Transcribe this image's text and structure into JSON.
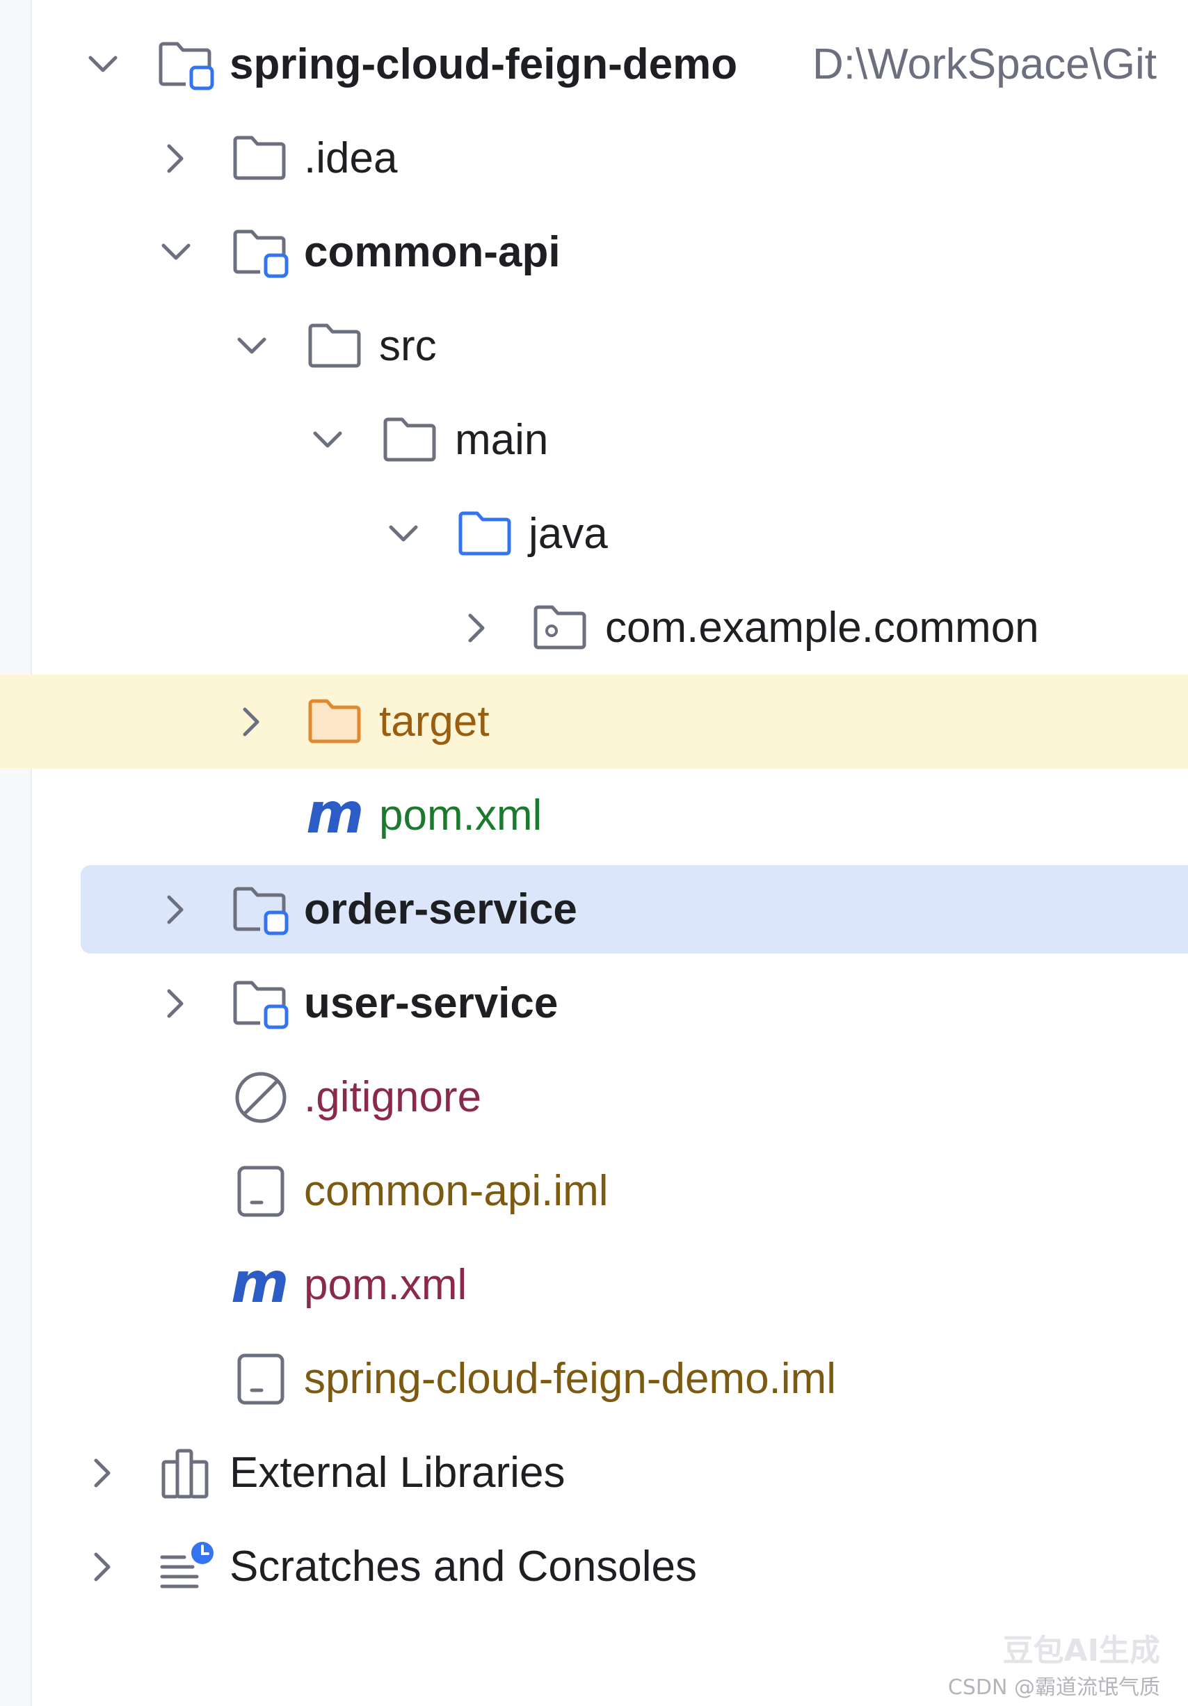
{
  "project": {
    "root": {
      "name": "spring-cloud-feign-demo",
      "path": "D:\\WorkSpace\\Git"
    },
    "items": {
      "idea": ".idea",
      "common_api": "common-api",
      "src": "src",
      "main": "main",
      "java": "java",
      "com_example_common": "com.example.common",
      "target": "target",
      "common_pom": "pom.xml",
      "order_service": "order-service",
      "user_service": "user-service",
      "gitignore": ".gitignore",
      "common_api_iml": "common-api.iml",
      "root_pom": "pom.xml",
      "root_iml": "spring-cloud-feign-demo.iml",
      "external_libraries": "External Libraries",
      "scratches": "Scratches and Consoles"
    },
    "icons": {
      "module": "module-folder-icon",
      "folder": "folder-icon",
      "source_folder": "source-folder-icon",
      "package": "package-icon",
      "excluded_folder": "excluded-folder-icon",
      "maven": "maven-icon",
      "ignore": "ignore-file-icon",
      "iml": "iml-file-icon",
      "libraries": "libraries-icon",
      "scratches": "scratches-icon"
    }
  },
  "colors": {
    "selection": "#dbe6fb",
    "excluded_highlight": "#fcf6d6",
    "module_accent": "#3574f0",
    "excluded_text": "#9b5e0f",
    "modified_text": "#1c7a2e",
    "ignored_text": "#8b2949",
    "unversioned_text": "#7d5a12"
  },
  "watermark": {
    "main": "豆包AI生成",
    "sub": "CSDN @霸道流氓气质"
  }
}
